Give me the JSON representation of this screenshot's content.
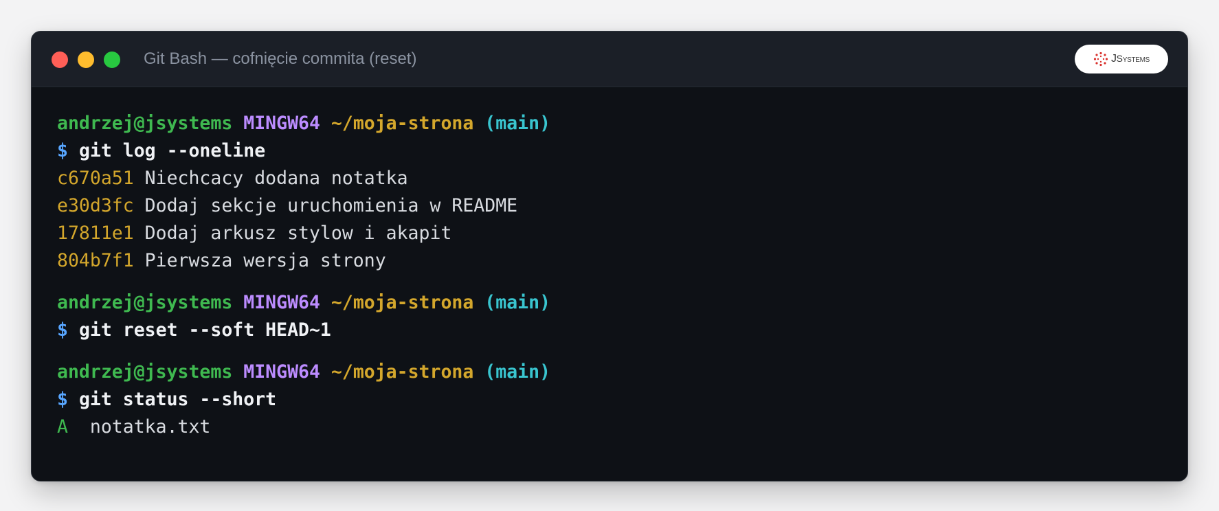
{
  "window": {
    "title": "Git Bash — cofnięcie commita (reset)",
    "logo": {
      "icon": "jsystems-logo-icon",
      "text_initial": "J",
      "text_rest": "Systems"
    }
  },
  "colors": {
    "user": "#3fb950",
    "shell": "#bc8cff",
    "path": "#d4a72c",
    "branch": "#39c5cf",
    "prompt": "#58a6ff",
    "hash": "#d4a72c"
  },
  "terminal": {
    "blocks": [
      {
        "prompt": {
          "user_host": "andrzej@jsystems",
          "shell": "MINGW64",
          "path": "~/moja-strona",
          "branch": "(main)"
        },
        "command": "git log --oneline",
        "output": [
          {
            "hash": "c670a51",
            "message": "Niechcacy dodana notatka"
          },
          {
            "hash": "e30d3fc",
            "message": "Dodaj sekcje uruchomienia w README"
          },
          {
            "hash": "17811e1",
            "message": "Dodaj arkusz stylow i akapit"
          },
          {
            "hash": "804b7f1",
            "message": "Pierwsza wersja strony"
          }
        ]
      },
      {
        "prompt": {
          "user_host": "andrzej@jsystems",
          "shell": "MINGW64",
          "path": "~/moja-strona",
          "branch": "(main)"
        },
        "command": "git reset --soft HEAD~1"
      },
      {
        "prompt": {
          "user_host": "andrzej@jsystems",
          "shell": "MINGW64",
          "path": "~/moja-strona",
          "branch": "(main)"
        },
        "command": "git status --short",
        "status": [
          {
            "flag": "A",
            "file": "notatka.txt"
          }
        ]
      }
    ],
    "prompt_symbol": "$"
  }
}
